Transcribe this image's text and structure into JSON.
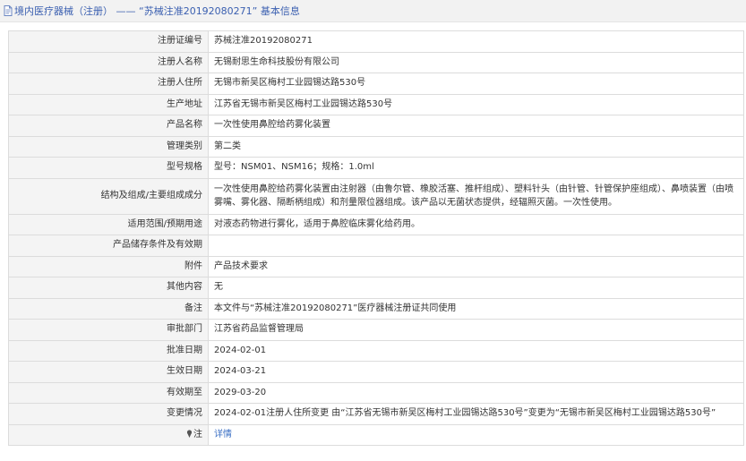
{
  "header": {
    "icon": "document-icon",
    "title": "境内医疗器械（注册） —— “苏械注准20192080271” 基本信息"
  },
  "rows": [
    {
      "label": "注册证编号",
      "value": "苏械注准20192080271"
    },
    {
      "label": "注册人名称",
      "value": "无锡耐思生命科技股份有限公司"
    },
    {
      "label": "注册人住所",
      "value": "无锡市新吴区梅村工业园锡达路530号"
    },
    {
      "label": "生产地址",
      "value": "江苏省无锡市新吴区梅村工业园锡达路530号"
    },
    {
      "label": "产品名称",
      "value": "一次性使用鼻腔给药雾化装置"
    },
    {
      "label": "管理类别",
      "value": "第二类"
    },
    {
      "label": "型号规格",
      "value": "型号：NSM01、NSM16；规格：1.0ml"
    },
    {
      "label": "结构及组成/主要组成成分",
      "value": "一次性使用鼻腔给药雾化装置由注射器（由鲁尔管、橡胶活塞、推杆组成）、塑料针头（由针管、针管保护座组成）、鼻喷装置（由喷雾嘴、雾化器、隔断柄组成）和剂量限位器组成。该产品以无菌状态提供，经辐照灭菌。一次性使用。"
    },
    {
      "label": "适用范围/预期用途",
      "value": "对液态药物进行雾化，适用于鼻腔临床雾化给药用。"
    },
    {
      "label": "产品储存条件及有效期",
      "value": ""
    },
    {
      "label": "附件",
      "value": "产品技术要求"
    },
    {
      "label": "其他内容",
      "value": "无"
    },
    {
      "label": "备注",
      "value": "本文件与“苏械注准20192080271”医疗器械注册证共同使用"
    },
    {
      "label": "审批部门",
      "value": "江苏省药品监督管理局"
    },
    {
      "label": "批准日期",
      "value": "2024-02-01"
    },
    {
      "label": "生效日期",
      "value": "2024-03-21"
    },
    {
      "label": "有效期至",
      "value": "2029-03-20"
    },
    {
      "label": "变更情况",
      "value": "2024-02-01注册人住所变更 由“江苏省无锡市新吴区梅村工业园锡达路530号”变更为“无锡市新吴区梅村工业园锡达路530号”"
    }
  ],
  "note_row": {
    "icon": "pin-icon",
    "label": "注",
    "link_text": "详情"
  }
}
